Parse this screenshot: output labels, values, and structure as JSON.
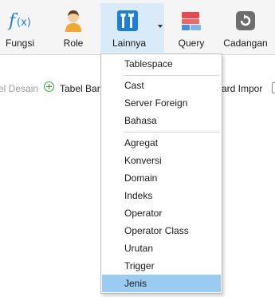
{
  "toolbar": {
    "items": [
      {
        "label": "Fungsi",
        "icon": "function-icon"
      },
      {
        "label": "Role",
        "icon": "user-role-icon"
      },
      {
        "label": "Lainnya",
        "icon": "tools-icon",
        "active": true
      },
      {
        "label": "Query",
        "icon": "query-icon"
      },
      {
        "label": "Cadangan",
        "icon": "backup-icon"
      }
    ]
  },
  "subbar": {
    "design_label": "el Desain",
    "new_table_label": "Tabel Baru",
    "import_label": "zard Impor"
  },
  "menu": {
    "items": [
      {
        "label": "Tablespace"
      },
      {
        "label": "Cast"
      },
      {
        "label": "Server Foreign"
      },
      {
        "label": "Bahasa"
      },
      {
        "label": "Agregat"
      },
      {
        "label": "Konversi"
      },
      {
        "label": "Domain"
      },
      {
        "label": "Indeks"
      },
      {
        "label": "Operator"
      },
      {
        "label": "Operator Class"
      },
      {
        "label": "Urutan"
      },
      {
        "label": "Trigger"
      },
      {
        "label": "Jenis",
        "selected": true
      }
    ]
  },
  "colors": {
    "active_tool_bg": "#d9eaf8",
    "selected_item_bg": "#99ccf0",
    "accent_blue": "#1e7fd8",
    "add_green": "#3aa83a"
  }
}
